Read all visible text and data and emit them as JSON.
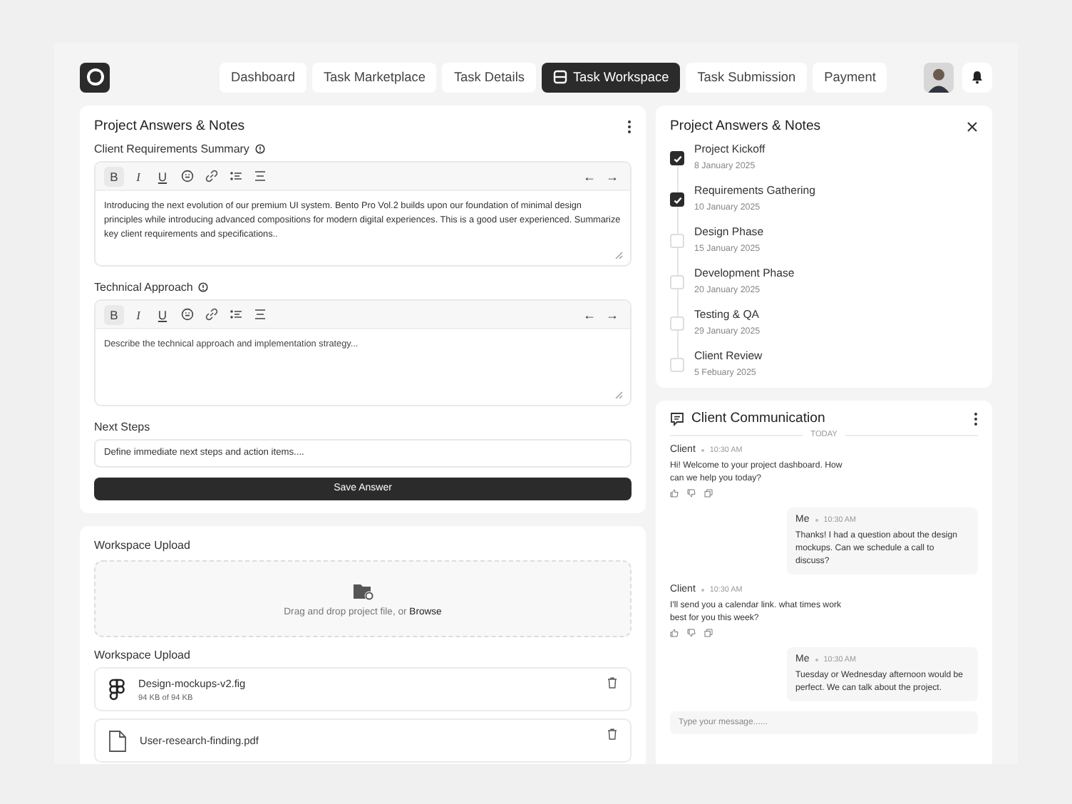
{
  "nav": {
    "tabs": [
      {
        "label": "Dashboard",
        "selected": false
      },
      {
        "label": "Task Marketplace",
        "selected": false
      },
      {
        "label": "Task Details",
        "selected": false
      },
      {
        "label": "Task Workspace",
        "selected": true
      },
      {
        "label": "Task Submission",
        "selected": false
      },
      {
        "label": "Payment",
        "selected": false
      }
    ]
  },
  "answers": {
    "title": "Project Answers & Notes",
    "editors": [
      {
        "label": "Client Requirements Summary",
        "value": "Introducing the next evolution of our premium UI system. Bento Pro Vol.2 builds upon our foundation of minimal design principles while introducing advanced compositions for modern digital experiences. This is a good user experienced. Summarize key client requirements and specifications..",
        "tools": [
          {
            "kind": "bold",
            "label": "B",
            "selected": true
          },
          {
            "kind": "italic",
            "label": "I",
            "selected": false
          },
          {
            "kind": "underline",
            "label": "U",
            "selected": false
          },
          {
            "kind": "emoji",
            "selected": false
          },
          {
            "kind": "link",
            "selected": false
          },
          {
            "kind": "list",
            "selected": false
          },
          {
            "kind": "align",
            "selected": false
          }
        ],
        "undo": "←",
        "redo": "→"
      },
      {
        "label": "Technical Approach",
        "placeholder": "Describe the technical approach and implementation strategy...",
        "tools": [
          {
            "kind": "bold",
            "label": "B",
            "selected": true
          },
          {
            "kind": "italic",
            "label": "I",
            "selected": false
          },
          {
            "kind": "underline",
            "label": "U",
            "selected": false
          },
          {
            "kind": "emoji",
            "selected": false
          },
          {
            "kind": "link",
            "selected": false
          },
          {
            "kind": "list",
            "selected": false
          },
          {
            "kind": "align",
            "selected": false
          }
        ],
        "undo": "←",
        "redo": "→"
      }
    ],
    "next_steps": {
      "label": "Next Steps",
      "placeholder": "Define immediate next steps and action items...."
    },
    "save_button": "Save Answer"
  },
  "upload": {
    "title": "Workspace Upload",
    "drop_text": "Drag and drop project file, or ",
    "browse": "Browse",
    "files_title": "Workspace Upload",
    "files": [
      {
        "kind": "figma",
        "name": "Design-mockups-v2.fig",
        "size": "94 KB of 94 KB"
      },
      {
        "kind": "document",
        "name": "User-research-finding.pdf"
      }
    ]
  },
  "timeline": {
    "title": "Project Answers & Notes",
    "items": [
      {
        "name": "Project Kickoff",
        "date": "8 January 2025",
        "checked": true
      },
      {
        "name": "Requirements Gathering",
        "date": "10 January 2025",
        "checked": true
      },
      {
        "name": "Design Phase",
        "date": "15 January 2025",
        "checked": false
      },
      {
        "name": "Development Phase",
        "date": "20 January 2025",
        "checked": false
      },
      {
        "name": "Testing & QA",
        "date": "29 January 2025",
        "checked": false
      },
      {
        "name": "Client Review",
        "date": "5 Febuary 2025",
        "checked": false
      }
    ]
  },
  "chat": {
    "title": "Client Communication",
    "day": "TODAY",
    "messages": [
      {
        "kind": "client",
        "sender": "Client",
        "time": "10:30 AM",
        "text": "Hi! Welcome to your project dashboard. How can we help you today?"
      },
      {
        "kind": "me",
        "sender": "Me",
        "time": "10:30 AM",
        "text": "Thanks! I had a question about the design mockups. Can we schedule a call to discuss?"
      },
      {
        "kind": "client",
        "sender": "Client",
        "time": "10:30 AM",
        "text": "I'll send you a calendar link. what times work best for you this week?"
      },
      {
        "kind": "me",
        "sender": "Me",
        "time": "10:30 AM",
        "text": "Tuesday or Wednesday afternoon would be perfect. We can talk about the project."
      }
    ],
    "placeholder": "Type your message......"
  }
}
